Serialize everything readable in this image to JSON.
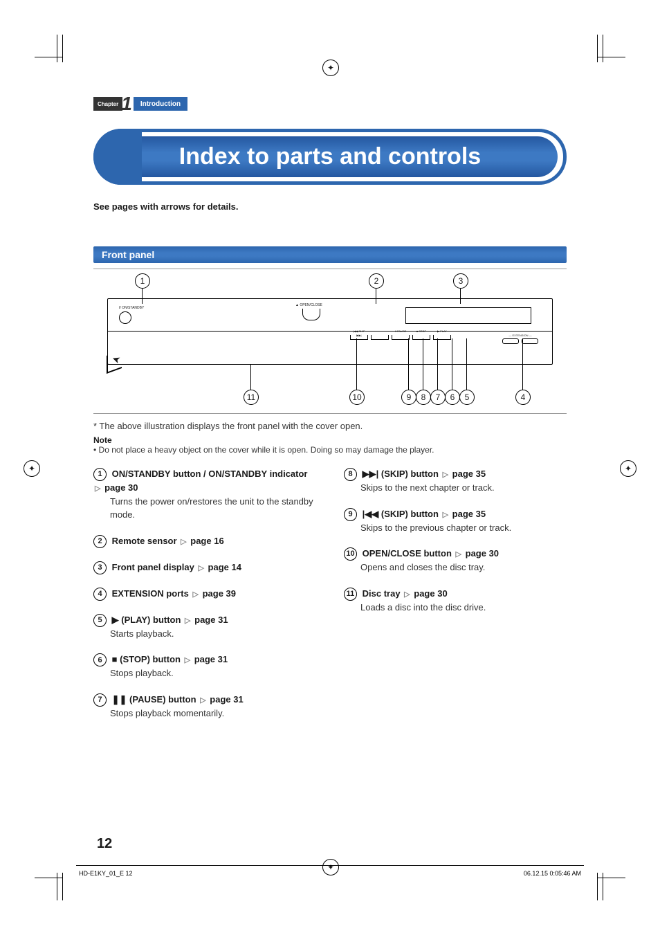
{
  "chapter": {
    "label": "Chapter",
    "number": "1",
    "name": "Introduction"
  },
  "page_title": "Index to parts and controls",
  "lead_text": "See pages with arrows for details.",
  "section_heading": "Front panel",
  "diagram": {
    "power_label": "I/ ON/STANDBY",
    "open_close_label": "▲ OPEN/CLOSE",
    "ext_label": "— EXTENSION —",
    "callouts": {
      "c1": "1",
      "c2": "2",
      "c3": "3",
      "c4": "4",
      "c5": "5",
      "c6": "6",
      "c7": "7",
      "c8": "8",
      "c9": "9",
      "c10": "10",
      "c11": "11"
    }
  },
  "under_diagram_note": "* The above illustration displays the front panel with the cover open.",
  "note_label": "Note",
  "note_body": "• Do not place a heavy object on the cover while it is open. Doing so may damage the player.",
  "items_left": [
    {
      "num": "1",
      "title": "ON/STANDBY button / ON/STANDBY indicator",
      "page": "page 30",
      "desc": "Turns the power on/restores the unit to the standby mode."
    },
    {
      "num": "2",
      "title": "Remote sensor",
      "page": "page 16",
      "desc": ""
    },
    {
      "num": "3",
      "title": "Front panel display",
      "page": "page 14",
      "desc": ""
    },
    {
      "num": "4",
      "title": "EXTENSION ports",
      "page": "page 39",
      "desc": ""
    },
    {
      "num": "5",
      "title_pre": "▶",
      "title": "(PLAY) button",
      "page": "page 31",
      "desc": "Starts playback."
    },
    {
      "num": "6",
      "title_pre": "■",
      "title": "(STOP) button",
      "page": "page 31",
      "desc": "Stops playback."
    },
    {
      "num": "7",
      "title_pre": "❚❚",
      "title": "(PAUSE) button",
      "page": "page 31",
      "desc": "Stops playback momentarily."
    }
  ],
  "items_right": [
    {
      "num": "8",
      "title_pre": "▶▶|",
      "title": "(SKIP) button",
      "page": "page 35",
      "desc": "Skips to the next chapter or track."
    },
    {
      "num": "9",
      "title_pre": "|◀◀",
      "title": "(SKIP) button",
      "page": "page 35",
      "desc": "Skips to the previous chapter or track."
    },
    {
      "num": "10",
      "title": "OPEN/CLOSE button",
      "page": "page 30",
      "desc": "Opens and closes the disc tray."
    },
    {
      "num": "11",
      "title": "Disc tray",
      "page": "page 30",
      "desc": "Loads a disc into the disc drive."
    }
  ],
  "page_number": "12",
  "footer_left": "HD-E1KY_01_E   12",
  "footer_right": "06.12.15   0:05:46 AM"
}
